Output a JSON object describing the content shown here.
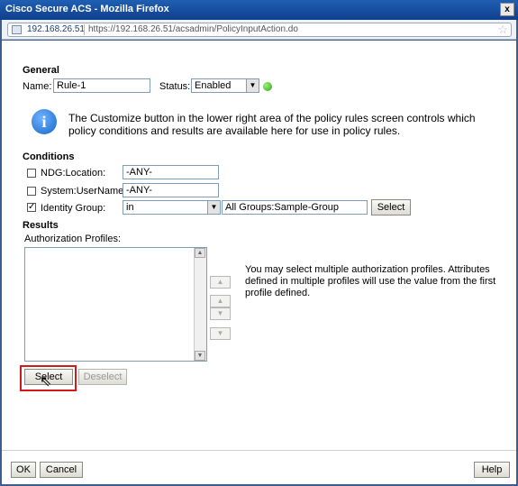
{
  "window": {
    "title": "Cisco Secure ACS - Mozilla Firefox",
    "close_label": "x"
  },
  "urlbar": {
    "host": "192.168.26.51",
    "url": "https://192.168.26.51/acsadmin/PolicyInputAction.do",
    "star": "☆"
  },
  "general": {
    "heading": "General",
    "name_label": "Name:",
    "name_value": "Rule-1",
    "status_label": "Status:",
    "status_value": "Enabled",
    "status_color": "#2aa51a"
  },
  "info": {
    "icon": "info-icon",
    "text_line1": "The Customize button in the lower right area of the policy rules screen controls which",
    "text_line2": "policy conditions and results are available here for use in policy rules."
  },
  "conditions": {
    "heading": "Conditions",
    "rows": [
      {
        "label": "NDG:Location:",
        "checked": false,
        "value": "-ANY-"
      },
      {
        "label": "System:UserName:",
        "checked": false,
        "value": "-ANY-"
      },
      {
        "label": "Identity Group:",
        "checked": true,
        "operator": "in",
        "value": "All Groups:Sample-Group",
        "select_label": "Select"
      }
    ]
  },
  "results": {
    "heading": "Results",
    "profiles_label": "Authorization Profiles:",
    "hint_line1": "You may select multiple authorization profiles. Attributes",
    "hint_line2": "defined in multiple profiles will use the value from the first",
    "hint_line3": "profile defined.",
    "select_label": "Select",
    "deselect_label": "Deselect"
  },
  "footer": {
    "ok_label": "OK",
    "cancel_label": "Cancel",
    "help_label": "Help"
  },
  "glyphs": {
    "check": "✓",
    "arrow_down": "▼",
    "arrow_up": "▲"
  },
  "accent_color": "#d21a1a"
}
